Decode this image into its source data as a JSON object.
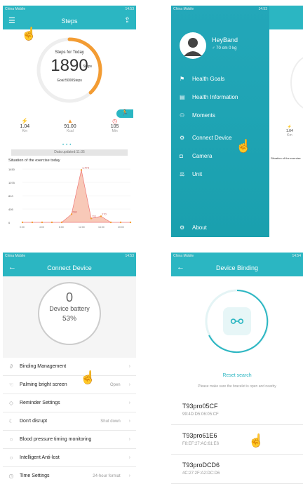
{
  "p1": {
    "status": {
      "carrier": "China Mobile",
      "time": "14:53"
    },
    "title": "Steps",
    "ring": {
      "label": "Steps for Today",
      "value": "1890",
      "unit": "Steps",
      "goal": "Goal:5000Steps",
      "progress": 0.38
    },
    "stats": [
      {
        "value": "1.04",
        "unit": "Km"
      },
      {
        "value": "91.00",
        "unit": "Kcal"
      },
      {
        "value": "105",
        "unit": "Min"
      }
    ],
    "updated": "Data updated:11:35",
    "chart_title": "Situation of the exercise today",
    "chart_data": {
      "type": "area",
      "x": [
        "0:00",
        "2:00",
        "4:00",
        "6:00",
        "8:00",
        "10:00",
        "12:00",
        "14:00",
        "16:00",
        "18:00",
        "20:00",
        "22:00"
      ],
      "y_ticks": [
        "1450",
        "1075",
        "810",
        "405",
        "0"
      ],
      "values": [
        0,
        0,
        0,
        0,
        0,
        230,
        1473,
        111,
        170,
        0,
        0,
        0
      ],
      "labels": [
        "1,473",
        "230",
        "111",
        "170"
      ],
      "ylim": [
        0,
        1500
      ]
    }
  },
  "p2": {
    "status": {
      "carrier": "China Mobile",
      "time": "14:53"
    },
    "profile": {
      "name": "HeyBand",
      "info": "♂ 70 cm   0 kg"
    },
    "menu": [
      "Health Goals",
      "Health Information",
      "Moments",
      "Connect Device",
      "Camera",
      "Unit"
    ],
    "about": "About",
    "peek_stat": "1.04",
    "peek_unit": "Km",
    "peek_chart": "Situation of the exercise"
  },
  "p3": {
    "status": {
      "carrier": "China Mobile",
      "time": "14:53"
    },
    "title": "Connect Device",
    "battery_label": "Device battery",
    "battery_value": "53%",
    "rows": [
      {
        "label": "Binding Management",
        "value": ""
      },
      {
        "label": "Palming bright screen",
        "value": "Open"
      },
      {
        "label": "Reminder Settings",
        "value": ""
      },
      {
        "label": "Don't disrupt",
        "value": "Shut down"
      },
      {
        "label": "Blood pressure timing monitoring",
        "value": ""
      },
      {
        "label": "Intelligent Anti-lost",
        "value": ""
      },
      {
        "label": "Time Settings",
        "value": "24-hour format"
      }
    ]
  },
  "p4": {
    "status": {
      "carrier": "China Mobile",
      "time": "14:54"
    },
    "title": "Device Binding",
    "reset": "Reset search",
    "hint": "Please make sure the bracelet is open and nearby",
    "devices": [
      {
        "name": "T93pro05CF",
        "mac": "99:4D:D5:06:05:CF"
      },
      {
        "name": "T93pro61E6",
        "mac": "F8:EF:27:AC:61:E6"
      },
      {
        "name": "T93proDCD6",
        "mac": "4C:27:2F:A2:DC:D6"
      }
    ]
  },
  "colors": {
    "accent": "#2bb6c2",
    "orange": "#f39c33"
  }
}
